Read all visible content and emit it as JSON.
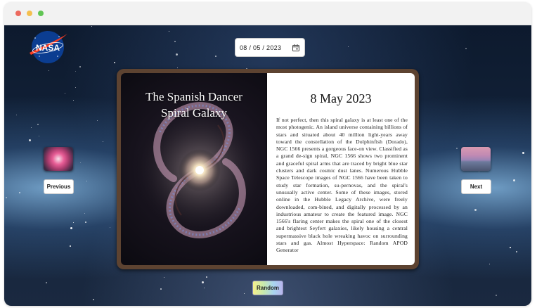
{
  "browser": {
    "buttons": [
      "close",
      "minimize",
      "maximize"
    ]
  },
  "logo": {
    "text": "NASA"
  },
  "date_picker": {
    "value": "08 / 05 / 2023",
    "icon": "calendar-icon"
  },
  "apod": {
    "title_line1": "The Spanish Dancer",
    "title_line2": "Spiral Galaxy",
    "date_heading": "8 May 2023",
    "explanation": "If not perfect, then this spiral galaxy is at least one of the most photogenic. An island universe containing billions of stars and situated about 40 million light-years away toward the constellation of the Dolphinfish (Dorado), NGC 1566 presents a gorgeous face-on view. Classified as a grand de-sign spiral, NGC 1566 shows two prominent and graceful spiral arms that are traced by bright blue star clusters and dark cosmic dust lanes. Numerous Hubble Space Telescope images of NGC 1566 have been taken to study star formation, su-pernovas, and the spiral's unusually active center. Some of these images, stored online in the Hubble Legacy Archive, were freely downloaded, com-bined, and digitally processed by an industrious amateur to create the featured image. NGC 1566's flaring center makes the spiral one of the closest and brightest Seyfert galaxies, likely housing a central supermassive black hole wreaking havoc on surrounding stars and gas. Almost Hyperspace: Random APOD Generator"
  },
  "navigation": {
    "previous_label": "Previous",
    "next_label": "Next",
    "random_label": "Random"
  }
}
